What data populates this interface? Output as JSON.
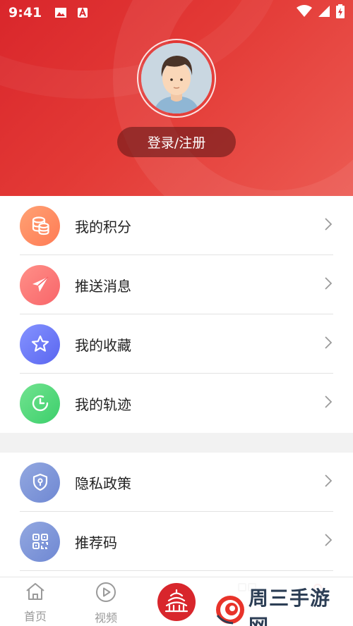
{
  "status_bar": {
    "time": "9:41"
  },
  "profile": {
    "login_label": "登录/注册"
  },
  "menu_group_1": [
    {
      "label": "我的积分",
      "icon": "coins-icon",
      "color_from": "#ff9a6a",
      "color_to": "#ff7b55"
    },
    {
      "label": "推送消息",
      "icon": "paper-plane-icon",
      "color_from": "#ff8a80",
      "color_to": "#f8656a"
    },
    {
      "label": "我的收藏",
      "icon": "star-icon",
      "color_from": "#7f8cff",
      "color_to": "#5a66f0"
    },
    {
      "label": "我的轨迹",
      "icon": "clock-icon",
      "color_from": "#6fe08c",
      "color_to": "#3ccf6b"
    }
  ],
  "menu_group_2": [
    {
      "label": "隐私政策",
      "icon": "shield-icon",
      "color_from": "#8fa4de",
      "color_to": "#6f88d3"
    },
    {
      "label": "推荐码",
      "icon": "qr-code-icon",
      "color_from": "#8fa4de",
      "color_to": "#6f88d3"
    }
  ],
  "bottom_nav": {
    "home": "首页",
    "video": "视频"
  },
  "watermark": {
    "text": "周三手游网"
  },
  "colors": {
    "header_red": "#d9262b",
    "page_bg": "#f2f2f2",
    "brand_red": "#d8262c"
  }
}
